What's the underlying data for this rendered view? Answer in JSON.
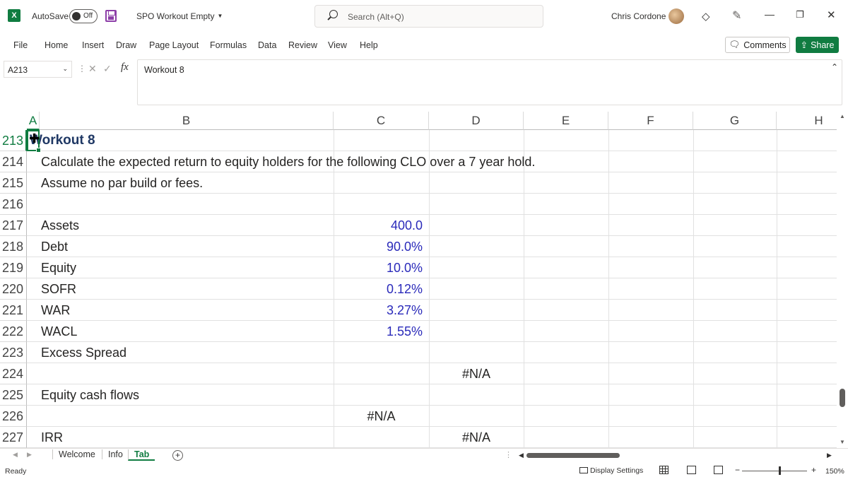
{
  "app": {
    "logo_letter": "X",
    "autosave_label": "AutoSave",
    "autosave_state": "Off",
    "document_title": "SPO Workout Empty",
    "search_placeholder": "Search (Alt+Q)",
    "user_name": "Chris Cordone",
    "accent_color": "#107c41"
  },
  "menu": [
    "File",
    "Home",
    "Insert",
    "Draw",
    "Page Layout",
    "Formulas",
    "Data",
    "Review",
    "View",
    "Help"
  ],
  "actions": {
    "comments": "Comments",
    "share": "Share"
  },
  "formula_bar": {
    "name_box": "A213",
    "formula": "Workout 8"
  },
  "columns": [
    "A",
    "B",
    "C",
    "D",
    "E",
    "F",
    "G",
    "H"
  ],
  "selected_column": "A",
  "rows": [
    {
      "num": "213",
      "a": "Workout 8"
    },
    {
      "num": "214",
      "b": "Calculate the expected return to equity holders for the following CLO over a 7 year hold."
    },
    {
      "num": "215",
      "b": "Assume no par build or fees."
    },
    {
      "num": "216"
    },
    {
      "num": "217",
      "b": "Assets",
      "c": "400.0"
    },
    {
      "num": "218",
      "b": "Debt",
      "c": "90.0%"
    },
    {
      "num": "219",
      "b": "Equity",
      "c": "10.0%"
    },
    {
      "num": "220",
      "b": "SOFR",
      "c": "0.12%"
    },
    {
      "num": "221",
      "b": "WAR",
      "c": "3.27%"
    },
    {
      "num": "222",
      "b": "WACL",
      "c": "1.55%"
    },
    {
      "num": "223",
      "b": "Excess Spread"
    },
    {
      "num": "224",
      "d": "#N/A"
    },
    {
      "num": "225",
      "b": "Equity cash flows"
    },
    {
      "num": "226",
      "c": "#N/A"
    },
    {
      "num": "227",
      "b": "IRR",
      "d": "#N/A"
    }
  ],
  "sheets": [
    "Welcome",
    "Info",
    "Tab"
  ],
  "active_sheet": "Tab",
  "status": {
    "mode": "Ready",
    "display_settings": "Display Settings",
    "zoom": "150%"
  }
}
